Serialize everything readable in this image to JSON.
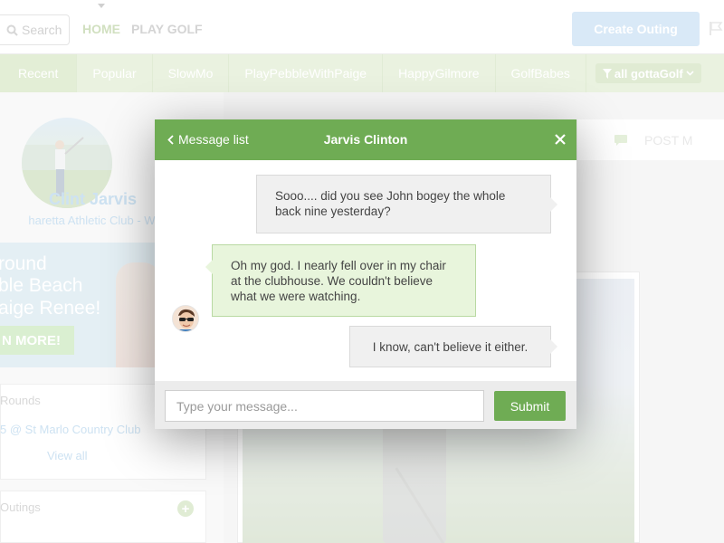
{
  "header": {
    "search_placeholder": "Search",
    "nav_home": "HOME",
    "nav_play_golf": "PLAY GOLF",
    "create_outing": "Create Outing"
  },
  "categories": {
    "items": [
      "Recent",
      "Popular",
      "SlowMo",
      "PlayPebbleWithPaige",
      "HappyGilmore",
      "GolfBabes"
    ],
    "filter": "all gottaGolf"
  },
  "profile": {
    "name": "Clint Jarvis",
    "club": "haretta Athletic Club - West"
  },
  "promo": {
    "line1": "round",
    "line2": "ble Beach",
    "line3": "aige Renee!",
    "button": "N MORE!"
  },
  "rounds": {
    "title": "Rounds",
    "item": "5 @ St Marlo Country Club",
    "view_all": "View all"
  },
  "outings": {
    "title": "Outings"
  },
  "post": {
    "label": "POST M"
  },
  "chat": {
    "back_label": "Message list",
    "contact_name": "Jarvis Clinton",
    "messages": [
      {
        "direction": "out",
        "text": "Sooo.... did you see John bogey the whole back nine yesterday?"
      },
      {
        "direction": "in",
        "text": "Oh my god.  I nearly fell over in my chair at the clubhouse.  We couldn't believe what we were watching."
      },
      {
        "direction": "out",
        "text": "I know, can't believe it either."
      }
    ],
    "input_placeholder": "Type your message...",
    "input_value": "",
    "submit_label": "Submit"
  },
  "colors": {
    "brand_green": "#6fac54",
    "incoming_bubble": "#e8f5dc",
    "outgoing_bubble": "#f0f0f0",
    "create_button": "#c5ddf3"
  }
}
